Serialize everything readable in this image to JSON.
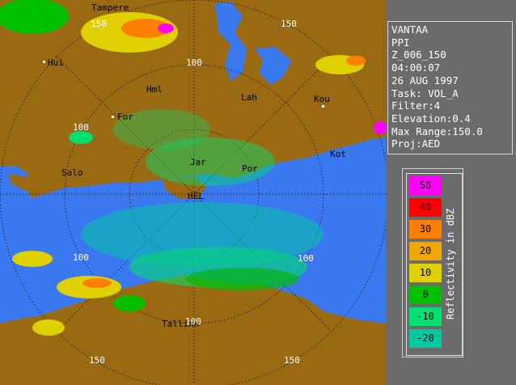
{
  "info": {
    "station": "VANTAA",
    "product": "PPI",
    "scan_id": "Z_006_150",
    "time": "04:00:07",
    "date": "26 AUG 1997",
    "task": "Task: VOL_A",
    "filter": "Filter:4",
    "elevation": "Elevation:0.4",
    "max_range": "Max Range:150.0",
    "projection": "Proj:AED"
  },
  "legend": {
    "title": "Reflectivity in dBZ",
    "levels": [
      {
        "label": "50",
        "color": "#ff00ff"
      },
      {
        "label": "40",
        "color": "#ff0000"
      },
      {
        "label": "30",
        "color": "#ff8000"
      },
      {
        "label": "20",
        "color": "#f0a800"
      },
      {
        "label": "10",
        "color": "#e0d000"
      },
      {
        "label": "0",
        "color": "#00c000"
      },
      {
        "label": "-10",
        "color": "#00e070"
      },
      {
        "label": "-20",
        "color": "#00c8a0"
      }
    ]
  },
  "map": {
    "land_color": "#9a6a12",
    "sea_color": "#3a78f0",
    "cities": {
      "tampere": "Tampere",
      "hui": "Hui",
      "hml": "Hml",
      "lah": "Lah",
      "kou": "Kou",
      "for": "For",
      "jar": "Jar",
      "por": "Por",
      "kot": "Kot",
      "salo": "Salo",
      "hel": "HEL",
      "tallinn": "Tallinn"
    },
    "range_labels": {
      "r150_tl": "150",
      "r150_tr": "150",
      "r100_top": "100",
      "r100_left": "100",
      "r100_right": "100",
      "r100_bl": "100",
      "r100_bottom": "100",
      "r150_bl": "150",
      "r150_br": "150"
    }
  }
}
